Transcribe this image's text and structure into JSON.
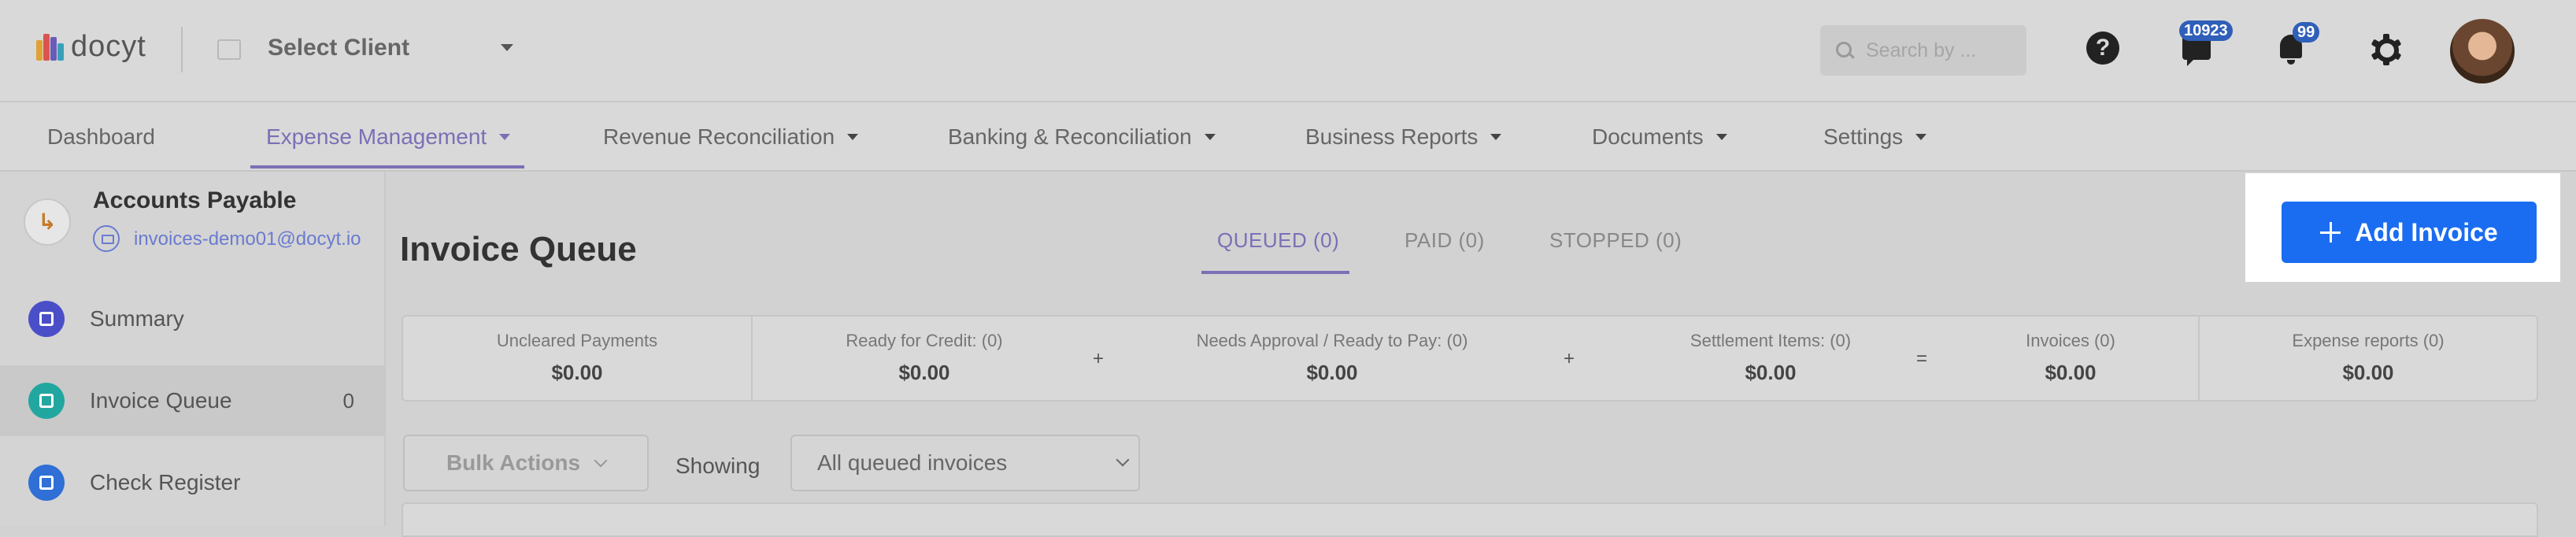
{
  "header": {
    "logo_text": "docyt",
    "client_select": "Select Client",
    "search_placeholder": "Search by ...",
    "help_glyph": "?",
    "messages_badge": "10923",
    "notifications_badge": "99",
    "icons": [
      "help-icon",
      "chat-icon",
      "bell-icon",
      "gear-icon"
    ],
    "colors": {
      "badge": "#2f5fb8"
    }
  },
  "nav": {
    "items": [
      {
        "label": "Dashboard",
        "has_dropdown": false
      },
      {
        "label": "Expense Management",
        "has_dropdown": true,
        "active": true
      },
      {
        "label": "Revenue Reconciliation",
        "has_dropdown": true
      },
      {
        "label": "Banking & Reconciliation",
        "has_dropdown": true
      },
      {
        "label": "Business Reports",
        "has_dropdown": true
      },
      {
        "label": "Documents",
        "has_dropdown": true
      },
      {
        "label": "Settings",
        "has_dropdown": true
      }
    ],
    "accent": "#7b6fb6"
  },
  "sidebar": {
    "title": "Accounts Payable",
    "email": "invoices-demo01@docyt.io",
    "items": [
      {
        "label": "Summary",
        "count": "",
        "icon": "summary-icon",
        "color": "#4a4fc8"
      },
      {
        "label": "Invoice Queue",
        "count": "0",
        "icon": "invoice-queue-icon",
        "color": "#22a7a0",
        "active": true
      },
      {
        "label": "Check Register",
        "count": "",
        "icon": "check-register-icon",
        "color": "#2f6fd6"
      }
    ]
  },
  "main": {
    "title": "Invoice Queue",
    "tabs": [
      {
        "label": "QUEUED (0)",
        "active": true
      },
      {
        "label": "PAID (0)"
      },
      {
        "label": "STOPPED (0)"
      }
    ],
    "add_invoice_label": "Add Invoice",
    "add_button_color": "#1a6df0",
    "summary": [
      {
        "label": "Uncleared Payments",
        "value": "$0.00"
      },
      {
        "label": "Ready for Credit: (0)",
        "value": "$0.00"
      },
      {
        "label": "Needs Approval / Ready to Pay: (0)",
        "value": "$0.00"
      },
      {
        "label": "Settlement Items: (0)",
        "value": "$0.00"
      },
      {
        "label": "Invoices (0)",
        "value": "$0.00"
      },
      {
        "label": "Expense reports (0)",
        "value": "$0.00"
      }
    ],
    "operators": [
      "+",
      "+",
      "="
    ],
    "bulk_actions": "Bulk Actions",
    "showing_label": "Showing",
    "queue_filter": "All queued invoices"
  }
}
